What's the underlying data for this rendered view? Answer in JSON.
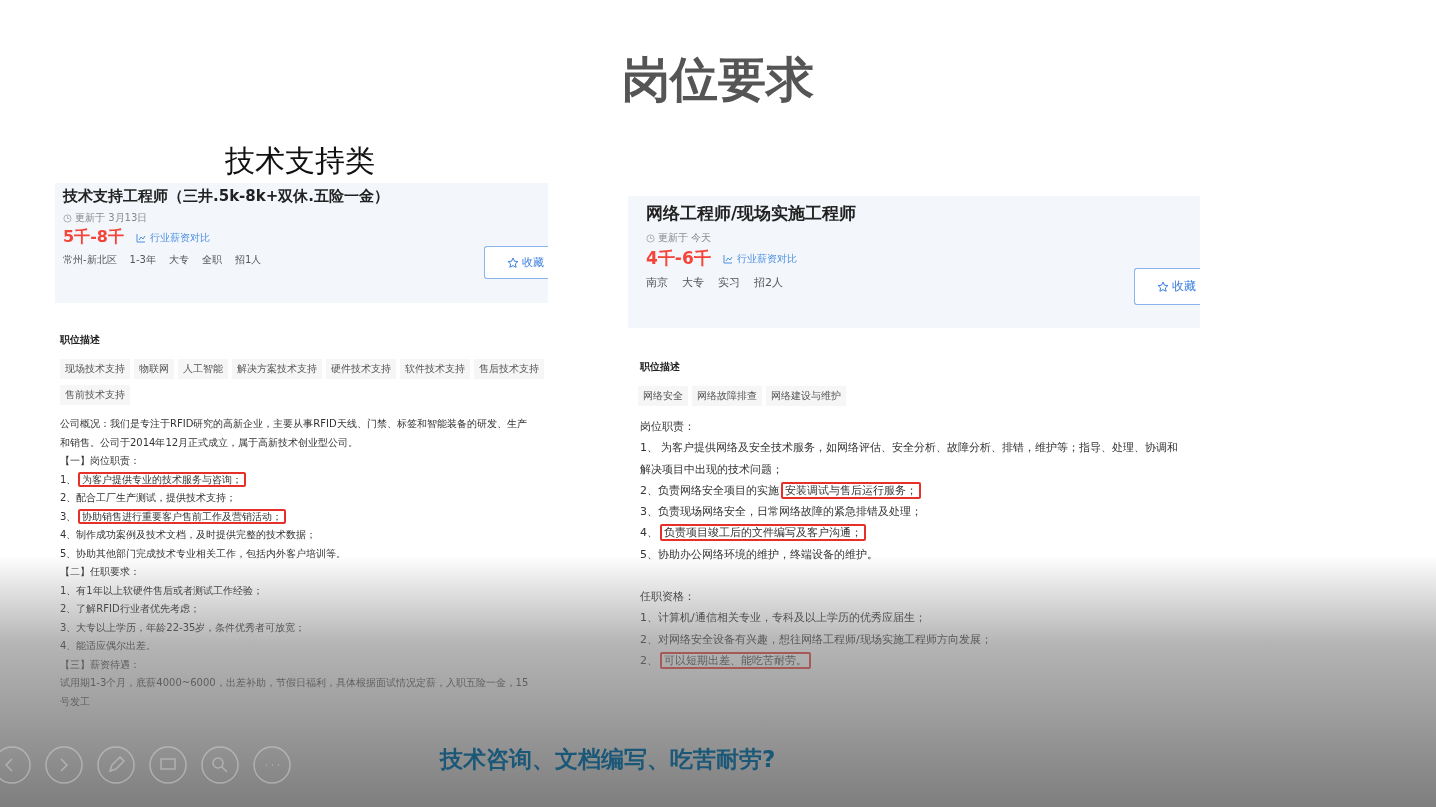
{
  "slide": {
    "title": "岗位要求",
    "subtitle": "技术支持类",
    "caption": "技术咨询、文档编写、吃苦耐劳?"
  },
  "jobs": [
    {
      "title": "技术支持工程师（三井.5k-8k+双休.五险一金）",
      "updated": "更新于 3月13日",
      "salary": "5千-8千",
      "compare_link": "行业薪资对比",
      "meta": [
        "常州-新北区",
        "1-3年",
        "大专",
        "全职",
        "招1人"
      ],
      "favorite_button": "收藏",
      "section_title": "职位描述",
      "tags": [
        "现场技术支持",
        "物联网",
        "人工智能",
        "解决方案技术支持",
        "硬件技术支持",
        "软件技术支持",
        "售后技术支持",
        "售前技术支持"
      ],
      "sections": [
        [
          {
            "text": "公司概况：我们是专注于RFID研究的高新企业，主要从事RFID天线、门禁、标签和智能装备的研发、生产和销售。公司于2014年12月正式成立，属于高新技术创业型公司。",
            "highlighted": false
          },
          {
            "text": "【一】岗位职责：",
            "highlighted": false
          },
          {
            "prefix": "1、",
            "text": "为客户提供专业的技术服务与咨询；",
            "highlighted": true
          },
          {
            "text": "2、配合工厂生产测试，提供技术支持；",
            "highlighted": false
          },
          {
            "prefix": "3、",
            "text": "协助销售进行重要客户售前工作及营销活动；",
            "highlighted": true
          },
          {
            "text": "4、制作成功案例及技术文档，及时提供完整的技术数据；",
            "highlighted": false
          },
          {
            "text": "5、协助其他部门完成技术专业相关工作，包括内外客户培训等。",
            "highlighted": false
          },
          {
            "text": "【二】任职要求：",
            "highlighted": false
          },
          {
            "text": "1、有1年以上软硬件售后或者测试工作经验；",
            "highlighted": false
          },
          {
            "text": "2、了解RFID行业者优先考虑；",
            "highlighted": false
          },
          {
            "text": "3、大专以上学历，年龄22-35岁，条件优秀者可放宽；",
            "highlighted": false
          },
          {
            "text": "4、能适应偶尔出差。",
            "highlighted": false
          },
          {
            "text": "【三】薪资待遇：",
            "highlighted": false
          },
          {
            "text": "试用期1-3个月，底薪4000~6000，出差补助，节假日福利，具体根据面试情况定薪，入职五险一金，15号发工",
            "highlighted": false
          }
        ]
      ]
    },
    {
      "title": "网络工程师/现场实施工程师",
      "updated": "更新于 今天",
      "salary": "4千-6千",
      "compare_link": "行业薪资对比",
      "meta": [
        "南京",
        "大专",
        "实习",
        "招2人"
      ],
      "favorite_button": "收藏",
      "section_title": "职位描述",
      "tags": [
        "网络安全",
        "网络故障排查",
        "网络建设与维护"
      ],
      "sections": [
        [
          {
            "text": "岗位职责：",
            "highlighted": false
          },
          {
            "text": "1、 为客户提供网络及安全技术服务，如网络评估、安全分析、故障分析、排错，维护等；指导、处理、协调和解决项目中出现的技术问题；",
            "highlighted": false
          },
          {
            "prefix": "2、负责网络安全项目的实施",
            "text": "安装调试与售后运行服务；",
            "highlighted": true
          },
          {
            "text": "3、负责现场网络安全，日常网络故障的紧急排错及处理；",
            "highlighted": false
          },
          {
            "prefix": "4、",
            "text": "负责项目竣工后的文件编写及客户沟通；",
            "highlighted": true
          },
          {
            "text": "5、协助办公网络环境的维护，终端设备的维护。",
            "highlighted": false
          }
        ],
        [
          {
            "text": "任职资格：",
            "highlighted": false
          },
          {
            "text": "1、计算机/通信相关专业，专科及以上学历的优秀应届生；",
            "highlighted": false
          },
          {
            "text": "2、对网络安全设备有兴趣，想往网络工程师/现场实施工程师方向发展；",
            "highlighted": false
          },
          {
            "prefix": "2、",
            "text": "可以短期出差、能吃苦耐劳。",
            "highlighted": true
          }
        ]
      ]
    }
  ]
}
